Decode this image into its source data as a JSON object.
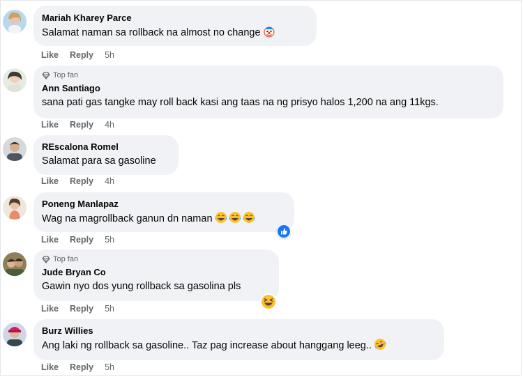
{
  "colors": {
    "bubble": "#f0f2f5",
    "meta_text": "#65676b",
    "like_blue": "#1877f2",
    "emoji_yellow": "#fbc02d"
  },
  "actions": {
    "like": "Like",
    "reply": "Reply"
  },
  "comments": [
    {
      "author": "Mariah Kharey Parce",
      "badge": "",
      "text": "Salamat naman sa rollback na almost no change",
      "emoji": "clown-face-icon",
      "time": "5h"
    },
    {
      "author": "Ann Santiago",
      "badge": "Top fan",
      "text": "sana pati gas tangke may roll back kasi ang taas na ng prisyo halos 1,200 na ang 11kgs.",
      "time": "4h"
    },
    {
      "author": "REscalona Romel",
      "badge": "",
      "text": "Salamat para sa gasoline",
      "time": "4h"
    },
    {
      "author": "Poneng Manlapaz",
      "badge": "",
      "text": "Wag na magrollback ganun dn naman",
      "emoji": "laughing-tears-icon",
      "emoji_count": 3,
      "reaction": "like-reaction-icon",
      "time": "5h"
    },
    {
      "author": "Jude Bryan Co",
      "badge": "Top fan",
      "text": "Gawin nyo dos yung rollback sa gasolina pls",
      "reaction": "squinting-laugh-reaction-icon",
      "time": "5h"
    },
    {
      "author": "Burz Willies",
      "badge": "",
      "text": "Ang laki ng rollback sa gasoline.. Taz pag increase about hanggang leeg..",
      "emoji": "rofl-icon",
      "time": "5h"
    }
  ]
}
